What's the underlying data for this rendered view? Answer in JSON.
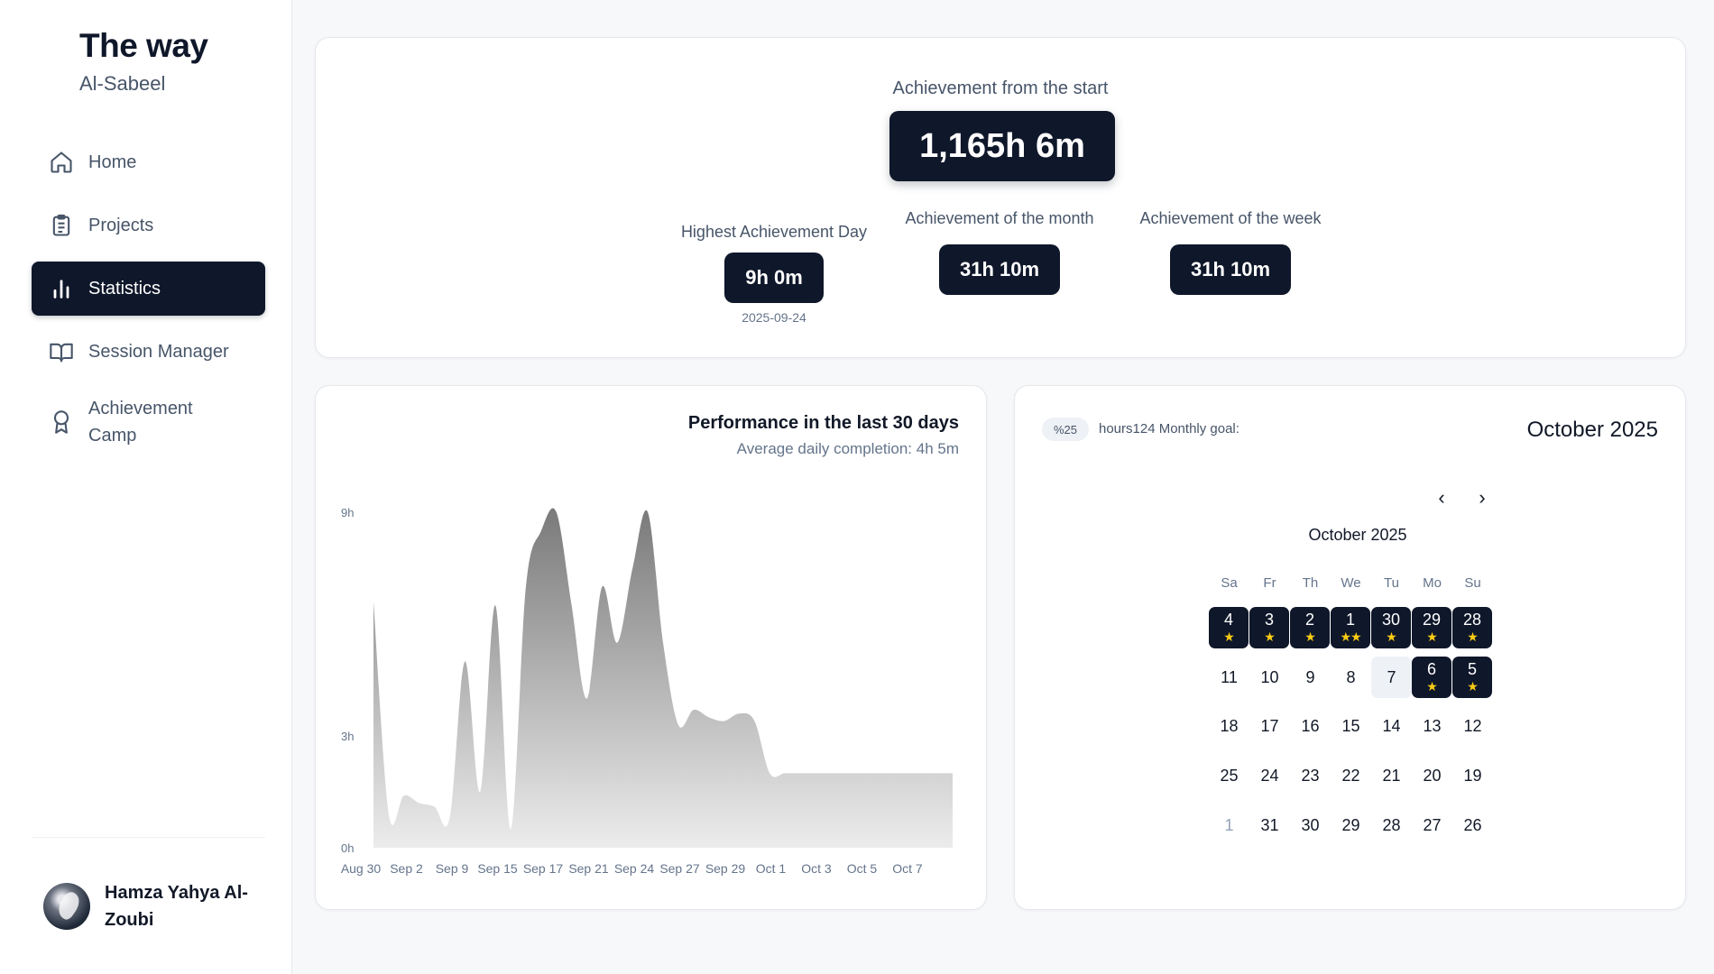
{
  "brand": {
    "title": "The way",
    "subtitle": "Al-Sabeel"
  },
  "nav": [
    {
      "label": "Home",
      "icon": "home-icon",
      "active": false
    },
    {
      "label": "Projects",
      "icon": "clipboard-icon",
      "active": false
    },
    {
      "label": "Statistics",
      "icon": "bar-chart-icon",
      "active": true
    },
    {
      "label": "Session Manager",
      "icon": "book-icon",
      "active": false
    },
    {
      "label": "Achievement Camp",
      "icon": "award-icon",
      "active": false
    }
  ],
  "user": {
    "name": "Hamza Yahya Al-Zoubi"
  },
  "summary": {
    "total_label": "Achievement from the start",
    "total_value": "1,165h 6m",
    "best_day_label": "Highest Achievement Day",
    "best_day_value": "9h 0m",
    "best_day_date": "2025-09-24",
    "month_label": "Achievement of the month",
    "month_value": "31h 10m",
    "week_label": "Achievement of the week",
    "week_value": "31h 10m"
  },
  "performance": {
    "title": "Performance in the last 30 days",
    "subtitle": "Average daily completion: 4h 5m"
  },
  "chart_data": {
    "type": "area",
    "title": "Performance in the last 30 days",
    "y_ticks": [
      "9h",
      "3h",
      "0h"
    ],
    "x_tick_labels": [
      "Aug 30",
      "Sep 2",
      "Sep 9",
      "Sep 15",
      "Sep 17",
      "Sep 21",
      "Sep 24",
      "Sep 27",
      "Sep 29",
      "Oct 1",
      "Oct 3",
      "Oct 5",
      "Oct 7"
    ],
    "ylim": [
      0,
      9
    ],
    "x": [
      "Aug 30",
      "Aug 31",
      "Sep 1",
      "Sep 2",
      "Sep 3",
      "Sep 4",
      "Sep 5",
      "Sep 6",
      "Sep 7",
      "Sep 8",
      "Sep 9",
      "Sep 10",
      "Sep 11",
      "Sep 12",
      "Sep 13",
      "Sep 14",
      "Sep 15",
      "Sep 16",
      "Sep 17",
      "Sep 18",
      "Sep 19",
      "Sep 20",
      "Sep 21",
      "Sep 22",
      "Sep 23",
      "Sep 24",
      "Sep 25",
      "Sep 26",
      "Sep 27",
      "Sep 28",
      "Sep 29",
      "Sep 30",
      "Oct 1",
      "Oct 2",
      "Oct 3",
      "Oct 4",
      "Oct 5",
      "Oct 6",
      "Oct 7"
    ],
    "values": [
      6.6,
      0.9,
      1.4,
      1.2,
      1.1,
      0.8,
      5.0,
      1.5,
      6.5,
      0.5,
      7.0,
      8.5,
      9.0,
      6.5,
      4.0,
      7.0,
      5.5,
      7.5,
      9.0,
      5.5,
      3.3,
      3.7,
      3.5,
      3.4,
      3.6,
      3.4,
      2.0,
      2.0,
      2.0,
      2.0,
      2.0,
      2.0,
      2.0,
      2.0,
      2.0,
      2.0,
      2.0,
      2.0,
      2.0
    ],
    "grid": false,
    "fill": "gray gradient"
  },
  "goal": {
    "percent": "%25",
    "text": "hours124 Monthly goal:"
  },
  "calendar": {
    "header_title": "October 2025",
    "month_label": "October 2025",
    "weekdays": [
      "Sa",
      "Fr",
      "Th",
      "We",
      "Tu",
      "Mo",
      "Su"
    ],
    "weeks": [
      [
        {
          "d": "4",
          "stars": 1
        },
        {
          "d": "3",
          "stars": 1
        },
        {
          "d": "2",
          "stars": 1
        },
        {
          "d": "1",
          "stars": 2
        },
        {
          "d": "30",
          "stars": 1
        },
        {
          "d": "29",
          "stars": 1
        },
        {
          "d": "28",
          "stars": 1
        }
      ],
      [
        {
          "d": "11",
          "stars": 0
        },
        {
          "d": "10",
          "stars": 0
        },
        {
          "d": "9",
          "stars": 0
        },
        {
          "d": "8",
          "stars": 0
        },
        {
          "d": "7",
          "stars": 0,
          "today": true
        },
        {
          "d": "6",
          "stars": 1
        },
        {
          "d": "5",
          "stars": 1
        }
      ],
      [
        {
          "d": "18",
          "stars": 0
        },
        {
          "d": "17",
          "stars": 0
        },
        {
          "d": "16",
          "stars": 0
        },
        {
          "d": "15",
          "stars": 0
        },
        {
          "d": "14",
          "stars": 0
        },
        {
          "d": "13",
          "stars": 0
        },
        {
          "d": "12",
          "stars": 0
        }
      ],
      [
        {
          "d": "25",
          "stars": 0
        },
        {
          "d": "24",
          "stars": 0
        },
        {
          "d": "23",
          "stars": 0
        },
        {
          "d": "22",
          "stars": 0
        },
        {
          "d": "21",
          "stars": 0
        },
        {
          "d": "20",
          "stars": 0
        },
        {
          "d": "19",
          "stars": 0
        }
      ],
      [
        {
          "d": "1",
          "stars": 0,
          "muted": true
        },
        {
          "d": "31",
          "stars": 0
        },
        {
          "d": "30",
          "stars": 0
        },
        {
          "d": "29",
          "stars": 0
        },
        {
          "d": "28",
          "stars": 0
        },
        {
          "d": "27",
          "stars": 0
        },
        {
          "d": "26",
          "stars": 0
        }
      ]
    ]
  },
  "colors": {
    "primary": "#0f172a",
    "star": "#facc15",
    "muted_text": "#475569",
    "background": "#f7f8fa"
  }
}
